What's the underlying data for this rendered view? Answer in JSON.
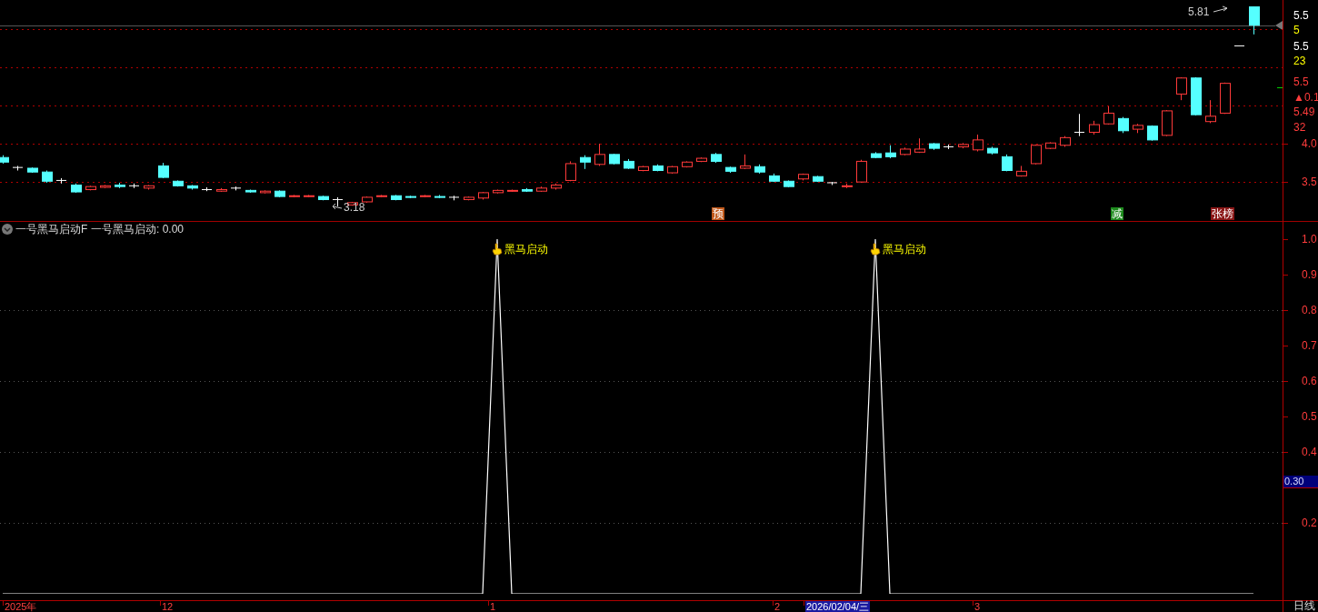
{
  "main_chart": {
    "last_price_label": "5.81",
    "low_label": "3.18",
    "chart_data": {
      "type": "candlestick",
      "ylim": [
        2.99,
        5.88
      ],
      "grid": true,
      "categories": [
        null,
        null,
        null,
        null,
        null,
        null,
        null,
        null,
        null,
        null,
        null,
        null,
        null,
        null,
        null,
        null,
        null,
        null,
        null,
        null,
        null,
        null,
        null,
        null,
        null,
        null,
        null,
        null,
        null,
        null,
        null,
        null,
        null,
        null,
        null,
        null,
        null,
        null,
        null,
        null,
        null,
        null,
        null,
        null,
        null,
        null,
        null,
        null,
        null,
        null,
        null,
        null,
        null,
        null,
        null,
        null,
        null,
        null,
        null,
        null,
        null,
        null,
        null,
        null,
        null,
        null,
        null,
        null,
        null,
        null,
        null,
        null,
        null,
        null,
        null,
        null,
        null,
        null,
        null,
        null,
        null,
        null,
        null,
        null,
        null,
        null,
        null
      ],
      "yticks": [
        {
          "value": 4.0,
          "label": "4.0"
        },
        {
          "value": 3.5,
          "label": "3.5"
        }
      ],
      "ohlc": [
        [
          3.82,
          3.85,
          3.74,
          3.76
        ],
        [
          3.69,
          3.71,
          3.65,
          3.69
        ],
        [
          3.68,
          3.69,
          3.62,
          3.63
        ],
        [
          3.63,
          3.65,
          3.49,
          3.51
        ],
        [
          3.52,
          3.55,
          3.48,
          3.52
        ],
        [
          3.46,
          3.48,
          3.36,
          3.37
        ],
        [
          3.4,
          3.45,
          3.39,
          3.44
        ],
        [
          3.43,
          3.46,
          3.42,
          3.45
        ],
        [
          3.46,
          3.49,
          3.42,
          3.44
        ],
        [
          3.45,
          3.48,
          3.42,
          3.45
        ],
        [
          3.42,
          3.46,
          3.4,
          3.45
        ],
        [
          3.71,
          3.75,
          3.55,
          3.56
        ],
        [
          3.51,
          3.52,
          3.44,
          3.45
        ],
        [
          3.45,
          3.46,
          3.4,
          3.42
        ],
        [
          3.4,
          3.43,
          3.38,
          3.4
        ],
        [
          3.38,
          3.42,
          3.37,
          3.4
        ],
        [
          3.42,
          3.44,
          3.39,
          3.42
        ],
        [
          3.39,
          3.4,
          3.36,
          3.37
        ],
        [
          3.36,
          3.39,
          3.35,
          3.38
        ],
        [
          3.38,
          3.39,
          3.3,
          3.31
        ],
        [
          3.31,
          3.33,
          3.3,
          3.32
        ],
        [
          3.31,
          3.33,
          3.3,
          3.32
        ],
        [
          3.31,
          3.32,
          3.26,
          3.27
        ],
        [
          3.27,
          3.3,
          3.18,
          3.27
        ],
        [
          3.2,
          3.24,
          3.19,
          3.23
        ],
        [
          3.24,
          3.31,
          3.23,
          3.3
        ],
        [
          3.31,
          3.33,
          3.3,
          3.32
        ],
        [
          3.32,
          3.33,
          3.26,
          3.27
        ],
        [
          3.31,
          3.32,
          3.29,
          3.3
        ],
        [
          3.31,
          3.33,
          3.3,
          3.32
        ],
        [
          3.31,
          3.33,
          3.29,
          3.3
        ],
        [
          3.3,
          3.32,
          3.26,
          3.3
        ],
        [
          3.27,
          3.31,
          3.26,
          3.3
        ],
        [
          3.29,
          3.37,
          3.27,
          3.36
        ],
        [
          3.36,
          3.4,
          3.35,
          3.39
        ],
        [
          3.38,
          3.4,
          3.37,
          3.39
        ],
        [
          3.4,
          3.42,
          3.37,
          3.38
        ],
        [
          3.38,
          3.44,
          3.37,
          3.42
        ],
        [
          3.42,
          3.48,
          3.4,
          3.46
        ],
        [
          3.52,
          3.77,
          3.51,
          3.74
        ],
        [
          3.82,
          3.85,
          3.67,
          3.76
        ],
        [
          3.73,
          4.0,
          3.71,
          3.86
        ],
        [
          3.86,
          3.87,
          3.73,
          3.74
        ],
        [
          3.77,
          3.8,
          3.67,
          3.68
        ],
        [
          3.65,
          3.71,
          3.64,
          3.7
        ],
        [
          3.71,
          3.73,
          3.64,
          3.65
        ],
        [
          3.62,
          3.71,
          3.61,
          3.7
        ],
        [
          3.7,
          3.77,
          3.69,
          3.76
        ],
        [
          3.77,
          3.82,
          3.76,
          3.81
        ],
        [
          3.86,
          3.88,
          3.75,
          3.77
        ],
        [
          3.69,
          3.7,
          3.62,
          3.64
        ],
        [
          3.68,
          3.86,
          3.67,
          3.71
        ],
        [
          3.7,
          3.73,
          3.61,
          3.63
        ],
        [
          3.58,
          3.61,
          3.5,
          3.51
        ],
        [
          3.51,
          3.52,
          3.43,
          3.44
        ],
        [
          3.54,
          3.61,
          3.52,
          3.6
        ],
        [
          3.57,
          3.58,
          3.5,
          3.51
        ],
        [
          3.49,
          3.5,
          3.46,
          3.49
        ],
        [
          3.44,
          3.48,
          3.42,
          3.45
        ],
        [
          3.5,
          3.79,
          3.49,
          3.77
        ],
        [
          3.87,
          3.89,
          3.81,
          3.82
        ],
        [
          3.88,
          3.98,
          3.81,
          3.83
        ],
        [
          3.86,
          3.95,
          3.85,
          3.93
        ],
        [
          3.89,
          4.07,
          3.88,
          3.93
        ],
        [
          4.0,
          4.01,
          3.92,
          3.94
        ],
        [
          3.96,
          3.99,
          3.93,
          3.96
        ],
        [
          3.96,
          4.01,
          3.94,
          3.99
        ],
        [
          3.92,
          4.12,
          3.9,
          4.05
        ],
        [
          3.94,
          3.96,
          3.86,
          3.88
        ],
        [
          3.83,
          3.86,
          3.64,
          3.65
        ],
        [
          3.58,
          3.71,
          3.57,
          3.64
        ],
        [
          3.74,
          3.99,
          3.73,
          3.98
        ],
        [
          3.94,
          4.02,
          3.93,
          4.01
        ],
        [
          3.98,
          4.1,
          3.96,
          4.08
        ],
        [
          4.15,
          4.39,
          4.1,
          4.15
        ],
        [
          4.15,
          4.3,
          4.12,
          4.25
        ],
        [
          4.26,
          4.49,
          4.25,
          4.4
        ],
        [
          4.33,
          4.35,
          4.14,
          4.17
        ],
        [
          4.19,
          4.26,
          4.14,
          4.24
        ],
        [
          4.23,
          4.24,
          4.04,
          4.05
        ],
        [
          4.11,
          4.44,
          4.1,
          4.43
        ],
        [
          4.65,
          4.87,
          4.57,
          4.86
        ],
        [
          4.86,
          4.87,
          4.37,
          4.38
        ],
        [
          4.29,
          4.57,
          4.27,
          4.36
        ],
        [
          4.4,
          4.8,
          4.39,
          4.79
        ],
        [
          5.28,
          5.28,
          5.28,
          5.28
        ],
        [
          5.79,
          5.79,
          5.43,
          5.55
        ]
      ]
    },
    "signals": [
      {
        "text": "预",
        "color": "#c0581a"
      },
      {
        "text": "减",
        "color": "#1d8a1d"
      },
      {
        "text": "张榜",
        "color": "#8a1616"
      }
    ]
  },
  "price_axis": {
    "labels": [
      {
        "text": "5.5",
        "color": "#ffffff"
      },
      {
        "text": "5",
        "color": "#ffff00"
      },
      {
        "text": "5.5",
        "color": "#ffffff"
      },
      {
        "text": "23",
        "color": "#ffff00"
      },
      {
        "text": "5.5",
        "color": "#ff3c3c"
      },
      {
        "text": "▲0.1",
        "color": "#ff3c3c"
      },
      {
        "text": "5.49",
        "color": "#ff3c3c"
      },
      {
        "text": "32",
        "color": "#ff3c3c"
      }
    ]
  },
  "indicator": {
    "title": "一号黑马启动F",
    "readout": "一号黑马启动: 0.00",
    "current_value": "0.30",
    "chart_data": {
      "type": "line",
      "ylim": [
        0,
        1
      ],
      "grid": true,
      "categories": [
        null,
        null,
        null,
        null,
        null,
        null,
        null,
        null,
        null,
        null,
        null,
        null,
        null,
        null,
        null,
        null,
        null,
        null,
        null,
        null,
        null,
        null,
        null,
        null,
        null,
        null,
        null,
        null,
        null,
        null,
        null,
        null,
        null,
        null,
        null,
        null,
        null,
        null,
        null,
        null,
        null,
        null,
        null,
        null,
        null,
        null,
        null,
        null,
        null,
        null,
        null,
        null,
        null,
        null,
        null,
        null,
        null,
        null,
        null,
        null,
        null,
        null,
        null,
        null,
        null,
        null,
        null,
        null,
        null,
        null,
        null,
        null,
        null,
        null,
        null,
        null,
        null,
        null,
        null,
        null,
        null,
        null,
        null,
        null,
        null,
        null,
        null
      ],
      "yticks": [
        {
          "value": 1.0,
          "label": "1.0"
        },
        {
          "value": 0.9,
          "label": "0.9"
        },
        {
          "value": 0.8,
          "label": "0.8"
        },
        {
          "value": 0.7,
          "label": "0.7"
        },
        {
          "value": 0.6,
          "label": "0.6"
        },
        {
          "value": 0.5,
          "label": "0.5"
        },
        {
          "value": 0.4,
          "label": "0.4"
        },
        {
          "value": 0.2,
          "label": "0.2"
        }
      ],
      "series": [
        {
          "color": "#ffffff",
          "values": [
            0,
            0,
            0,
            0,
            0,
            0,
            0,
            0,
            0,
            0,
            0,
            0,
            0,
            0,
            0,
            0,
            0,
            0,
            0,
            0,
            0,
            0,
            0,
            0,
            0,
            0,
            0,
            0,
            0,
            0,
            0,
            0,
            0,
            0,
            1,
            0,
            0,
            0,
            0,
            0,
            0,
            0,
            0,
            0,
            0,
            0,
            0,
            0,
            0,
            0,
            0,
            0,
            0,
            0,
            0,
            0,
            0,
            0,
            0,
            0,
            1,
            0,
            0,
            0,
            0,
            0,
            0,
            0,
            0,
            0,
            0,
            0,
            0,
            0,
            0,
            0,
            0,
            0,
            0,
            0,
            0,
            0,
            0,
            0,
            0,
            0,
            0
          ]
        }
      ]
    },
    "peak_labels": [
      {
        "text": "黑马启动"
      },
      {
        "text": "黑马启动"
      }
    ]
  },
  "time_axis": {
    "labels": [
      {
        "text": "2025年",
        "selected": false
      },
      {
        "text": "12",
        "selected": false
      },
      {
        "text": "1",
        "selected": false
      },
      {
        "text": "2",
        "selected": false
      },
      {
        "text": "2026/02/04/三",
        "selected": true
      },
      {
        "text": "3",
        "selected": false
      }
    ],
    "period": "日线"
  }
}
